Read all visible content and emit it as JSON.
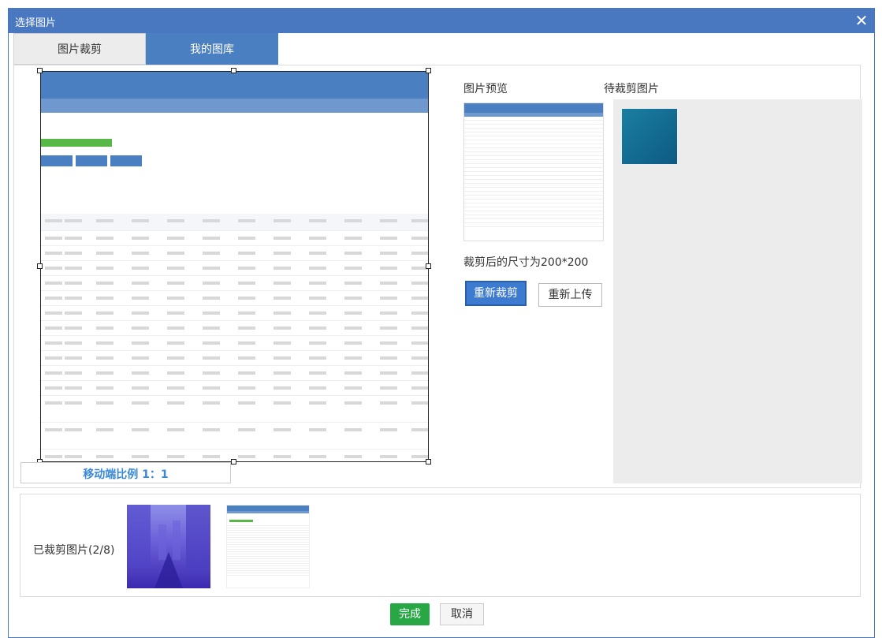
{
  "dialog": {
    "title": "选择图片",
    "close_icon": "close-icon"
  },
  "tabs": [
    {
      "label": "图片裁剪"
    },
    {
      "label": "我的图库"
    }
  ],
  "crop": {
    "ratio_label": "移动端比例 1：1"
  },
  "preview": {
    "label": "图片预览",
    "size_text": "裁剪后的尺寸为200*200",
    "recrop_label": "重新裁剪",
    "reupload_label": "重新上传"
  },
  "pending": {
    "label": "待裁剪图片"
  },
  "cropped": {
    "label": "已裁剪图片(2/8)"
  },
  "footer": {
    "done_label": "完成",
    "cancel_label": "取消"
  },
  "colors": {
    "accent": "#4a78c0",
    "done": "#28a745",
    "ratio_text": "#3a88d8"
  }
}
